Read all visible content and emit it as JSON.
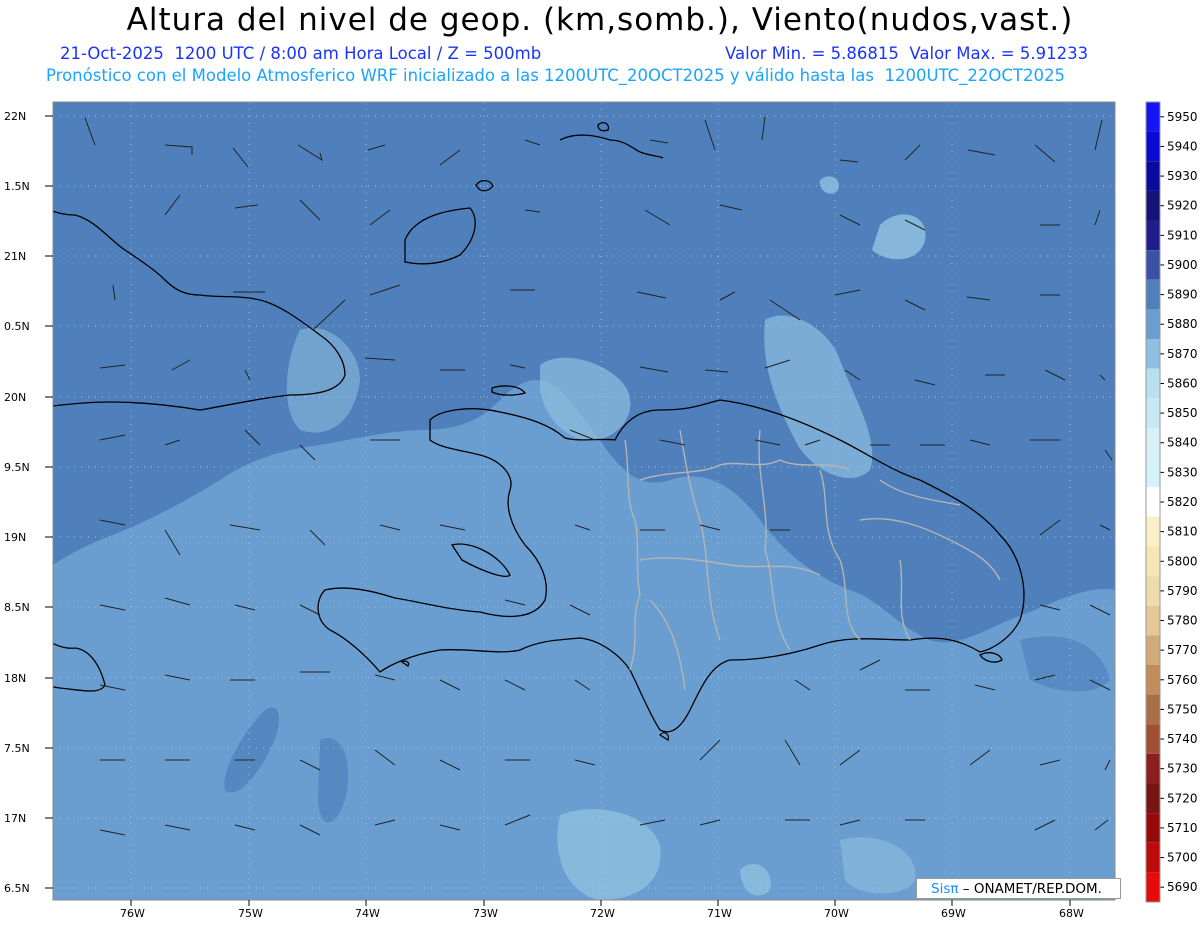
{
  "header": {
    "title": "Altura del nivel de geop. (km,somb.), Viento(nudos,vast.)",
    "line1_left": "21-Oct-2025  1200 UTC / 8:00 am Hora Local / Z = 500mb",
    "line1_right": "Valor Min. = 5.86815  Valor Max. = 5.91233",
    "line2": "Pronóstico con el Modelo Atmosferico WRF inicializado a las 1200UTC_20OCT2025 y válido hasta las  1200UTC_22OCT2025"
  },
  "map": {
    "lat_labels": [
      "22N",
      "1.5N",
      "21N",
      "0.5N",
      "20N",
      "9.5N",
      "19N",
      "8.5N",
      "18N",
      "7.5N",
      "17N",
      "6.5N"
    ],
    "lon_labels": [
      "76W",
      "75W",
      "74W",
      "73W",
      "72W",
      "71W",
      "70W",
      "69W",
      "68W"
    ],
    "base_color": "#6a9ed0",
    "north_color": "#4f80bb",
    "light_color": "#8fbfe0",
    "pale_color": "#a8d4ea"
  },
  "colorbar": {
    "labels": [
      "5950",
      "5940",
      "5930",
      "5920",
      "5910",
      "5900",
      "5890",
      "5880",
      "5870",
      "5860",
      "5850",
      "5840",
      "5830",
      "5820",
      "5810",
      "5800",
      "5790",
      "5780",
      "5770",
      "5760",
      "5750",
      "5740",
      "5730",
      "5720",
      "5710",
      "5700",
      "5690"
    ],
    "colors": [
      "#1414f5",
      "#0a0ad2",
      "#0a0aa0",
      "#141478",
      "#1e1e8c",
      "#3c50a8",
      "#4f80bb",
      "#6a9ed0",
      "#8fbfe0",
      "#b8e0f0",
      "#c8e8f4",
      "#d8f0f8",
      "#d4f2fa",
      "#ffffff",
      "#faf0c8",
      "#f5e6b4",
      "#eedcaa",
      "#e6c896",
      "#d2aa78",
      "#c08c5a",
      "#aa6e46",
      "#a05032",
      "#8c1e1e",
      "#781414",
      "#960a0a",
      "#be0a0a",
      "#e60a0a"
    ]
  },
  "credit": {
    "brand": "Sisπ",
    "text": "– ONAMET/REP.DOM."
  }
}
